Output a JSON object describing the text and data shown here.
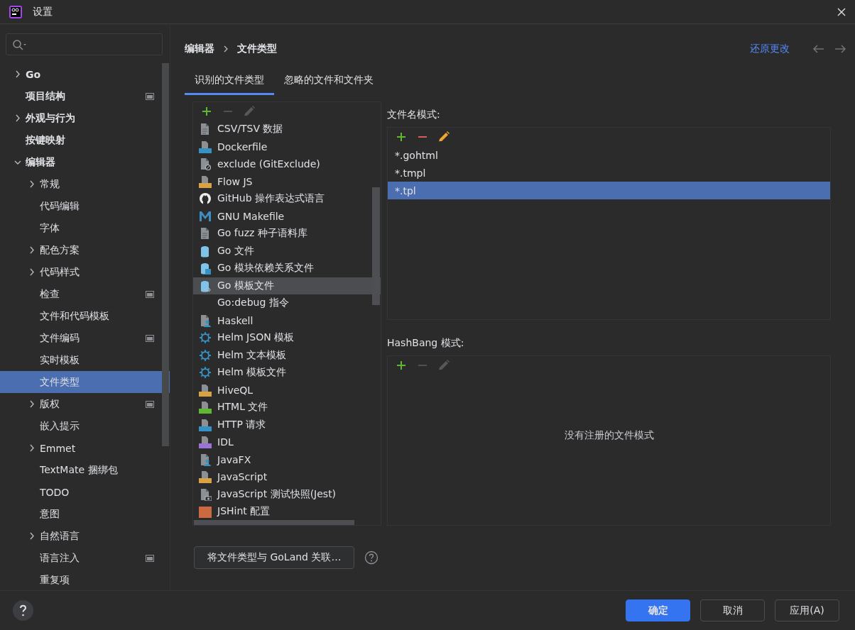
{
  "window": {
    "title": "设置"
  },
  "sidebar": {
    "items": [
      {
        "label": "Go",
        "expanded": false,
        "badge": false,
        "selected": false
      },
      {
        "label": "项目结构",
        "badge": true,
        "selected": false
      },
      {
        "label": "外观与行为",
        "expanded": false,
        "badge": false,
        "selected": false
      },
      {
        "label": "按键映射",
        "badge": false,
        "selected": false
      },
      {
        "label": "编辑器",
        "expanded": true,
        "badge": false,
        "selected": false,
        "children": [
          {
            "label": "常规",
            "expanded": false,
            "badge": false,
            "selected": false
          },
          {
            "label": "代码编辑",
            "badge": false,
            "selected": false
          },
          {
            "label": "字体",
            "badge": false,
            "selected": false
          },
          {
            "label": "配色方案",
            "expanded": false,
            "badge": false,
            "selected": false
          },
          {
            "label": "代码样式",
            "expanded": false,
            "badge": false,
            "selected": false
          },
          {
            "label": "检查",
            "badge": true,
            "selected": false
          },
          {
            "label": "文件和代码模板",
            "badge": false,
            "selected": false
          },
          {
            "label": "文件编码",
            "badge": true,
            "selected": false
          },
          {
            "label": "实时模板",
            "badge": false,
            "selected": false
          },
          {
            "label": "文件类型",
            "badge": false,
            "selected": true
          },
          {
            "label": "版权",
            "expanded": false,
            "badge": true,
            "selected": false
          },
          {
            "label": "嵌入提示",
            "badge": false,
            "selected": false
          },
          {
            "label": "Emmet",
            "expanded": false,
            "badge": false,
            "selected": false
          },
          {
            "label": "TextMate 捆绑包",
            "badge": false,
            "selected": false
          },
          {
            "label": "TODO",
            "badge": false,
            "selected": false
          },
          {
            "label": "意图",
            "badge": false,
            "selected": false
          },
          {
            "label": "自然语言",
            "expanded": false,
            "badge": false,
            "selected": false
          },
          {
            "label": "语言注入",
            "badge": true,
            "selected": false
          },
          {
            "label": "重复项",
            "badge": false,
            "selected": false
          }
        ]
      }
    ]
  },
  "breadcrumb": [
    "编辑器",
    "文件类型"
  ],
  "reset_link": "还原更改",
  "tabs": [
    {
      "label": "识别的文件类型",
      "selected": true
    },
    {
      "label": "忽略的文件和文件夹",
      "selected": false
    }
  ],
  "file_types": {
    "toolbar": [
      {
        "kind": "add",
        "disabled": false
      },
      {
        "kind": "remove",
        "disabled": true
      },
      {
        "kind": "edit",
        "disabled": true
      }
    ],
    "items": [
      {
        "label": "CSV/TSV 数据",
        "kind": "doc",
        "selected": false
      },
      {
        "label": "Dockerfile",
        "kind": "docker",
        "selected": false
      },
      {
        "label": "exclude (GitExclude)",
        "kind": "ignore",
        "selected": false
      },
      {
        "label": "Flow JS",
        "kind": "js",
        "selected": false
      },
      {
        "label": "GitHub 操作表达式语言",
        "kind": "github",
        "selected": false
      },
      {
        "label": "GNU Makefile",
        "kind": "makefile",
        "selected": false
      },
      {
        "label": "Go fuzz 种子语料库",
        "kind": "doc",
        "selected": false
      },
      {
        "label": "Go 文件",
        "kind": "gopher",
        "selected": false
      },
      {
        "label": "Go 模块依赖关系文件",
        "kind": "gopher-mod",
        "selected": false
      },
      {
        "label": "Go 模板文件",
        "kind": "gopher-tpl",
        "selected": true
      },
      {
        "label": "Go:debug 指令",
        "kind": "none",
        "selected": false
      },
      {
        "label": "Haskell",
        "kind": "person",
        "selected": false
      },
      {
        "label": "Helm JSON 模板",
        "kind": "helm",
        "selected": false
      },
      {
        "label": "Helm 文本模板",
        "kind": "helm",
        "selected": false
      },
      {
        "label": "Helm 模板文件",
        "kind": "helm",
        "selected": false
      },
      {
        "label": "HiveQL",
        "kind": "hql",
        "selected": false
      },
      {
        "label": "HTML 文件",
        "kind": "html",
        "selected": false
      },
      {
        "label": "HTTP 请求",
        "kind": "api",
        "selected": false
      },
      {
        "label": "IDL",
        "kind": "idl",
        "selected": false
      },
      {
        "label": "JavaFX",
        "kind": "person",
        "selected": false
      },
      {
        "label": "JavaScript",
        "kind": "js",
        "selected": false
      },
      {
        "label": "JavaScript 测试快照(Jest)",
        "kind": "camera",
        "selected": false
      },
      {
        "label": "JSHint 配置",
        "kind": "jshint",
        "selected": false
      }
    ]
  },
  "filename_patterns": {
    "label": "文件名模式:",
    "toolbar": [
      {
        "kind": "add",
        "disabled": false
      },
      {
        "kind": "remove",
        "disabled": false
      },
      {
        "kind": "edit",
        "disabled": false
      }
    ],
    "items": [
      {
        "label": "*.gohtml",
        "selected": false
      },
      {
        "label": "*.tmpl",
        "selected": false
      },
      {
        "label": "*.tpl",
        "selected": true
      }
    ]
  },
  "hashbang_patterns": {
    "label": "HashBang 模式:",
    "toolbar": [
      {
        "kind": "add",
        "disabled": false
      },
      {
        "kind": "remove",
        "disabled": true
      },
      {
        "kind": "edit",
        "disabled": true
      }
    ],
    "empty_text": "没有注册的文件模式"
  },
  "associate_button": "将文件类型与 GoLand 关联…",
  "footer": {
    "buttons": [
      {
        "label": "确定",
        "kind": "primary"
      },
      {
        "label": "取消",
        "kind": "normal"
      },
      {
        "label": "应用(A)",
        "kind": "normal"
      }
    ]
  }
}
